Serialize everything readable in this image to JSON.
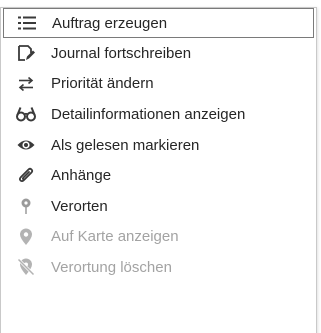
{
  "menu": {
    "items": [
      {
        "label": "Auftrag erzeugen",
        "icon": "list-icon",
        "enabled": true
      },
      {
        "label": "Journal fortschreiben",
        "icon": "journal-edit-icon",
        "enabled": true
      },
      {
        "label": "Priorität ändern",
        "icon": "swap-arrows-icon",
        "enabled": true
      },
      {
        "label": "Detailinformationen anzeigen",
        "icon": "glasses-icon",
        "enabled": true
      },
      {
        "label": "Als gelesen markieren",
        "icon": "eye-icon",
        "enabled": true
      },
      {
        "label": "Anhänge",
        "icon": "paperclip-icon",
        "enabled": true
      },
      {
        "label": "Verorten",
        "icon": "location-pin-icon",
        "enabled": true
      },
      {
        "label": "Auf Karte anzeigen",
        "icon": "map-marker-icon",
        "enabled": false
      },
      {
        "label": "Verortung löschen",
        "icon": "location-off-icon",
        "enabled": false
      }
    ]
  },
  "colors": {
    "text": "#262626",
    "disabled_text": "#a3a3a3",
    "icon": "#3a3a3a",
    "disabled_icon": "#b3b3b3",
    "hover_border": "#7a7a7a"
  }
}
